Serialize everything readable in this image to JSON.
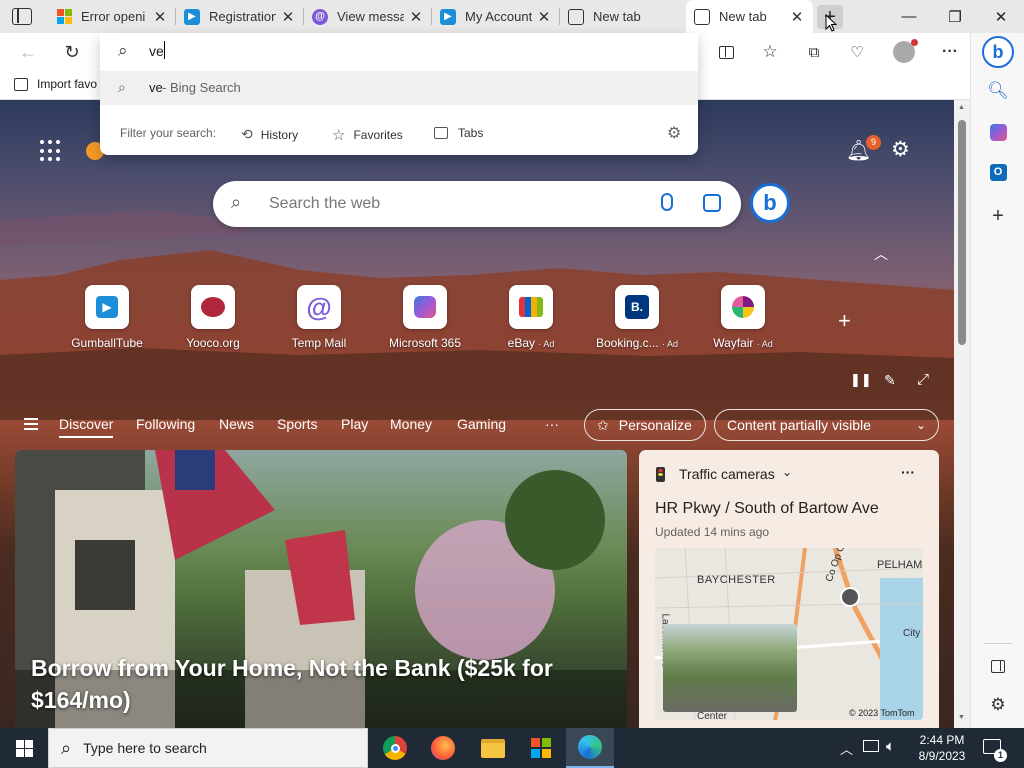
{
  "tabs": [
    {
      "title": "Error openi",
      "icon": "microsoft-icon"
    },
    {
      "title": "Registration",
      "icon": "video-icon"
    },
    {
      "title": "View messa",
      "icon": "at-icon"
    },
    {
      "title": "My Account",
      "icon": "video-icon"
    },
    {
      "title": "New tab",
      "icon": "newtab-icon"
    },
    {
      "title": "New tab",
      "icon": "newtab-icon",
      "active": true
    }
  ],
  "address": {
    "value": "ve"
  },
  "dropdown": {
    "suggestion_query": "ve",
    "suggestion_suffix": " - Bing Search",
    "filter_label": "Filter your search:",
    "filters": [
      "History",
      "Favorites",
      "Tabs"
    ]
  },
  "favorites_bar": {
    "import_label": "Import favo"
  },
  "ntp": {
    "search_placeholder": "Search the web",
    "notification_count": "9",
    "tiles": [
      {
        "label": "GumballTube",
        "ad": ""
      },
      {
        "label": "Yooco.org",
        "ad": ""
      },
      {
        "label": "Temp Mail",
        "ad": ""
      },
      {
        "label": "Microsoft 365",
        "ad": ""
      },
      {
        "label": "eBay",
        "ad": "· Ad"
      },
      {
        "label": "Booking.c...",
        "ad": "· Ad"
      },
      {
        "label": "Wayfair",
        "ad": "· Ad"
      }
    ],
    "nav": [
      "Discover",
      "Following",
      "News",
      "Sports",
      "Play",
      "Money",
      "Gaming"
    ],
    "more": "···",
    "personalize": "Personalize",
    "content_visibility": "Content partially visible"
  },
  "hero": {
    "headline": "Borrow from Your Home, Not the Bank ($25k for $164/mo)"
  },
  "traffic": {
    "header": "Traffic cameras",
    "location": "HR Pkwy / South of Bartow Ave",
    "updated": "Updated 14 mins ago",
    "map_labels": [
      "BAYCHESTER",
      "PELHAM",
      "Co Op Cit",
      "Laconia Ave",
      "Center",
      "City"
    ],
    "copyright": "© 2023 TomTom"
  },
  "taskbar": {
    "search_placeholder": "Type here to search",
    "time": "2:44 PM",
    "date": "8/9/2023",
    "notification_badge": "1"
  },
  "colors": {
    "accent": "#0067c0",
    "bing_blue": "#1a6fd6",
    "badge_orange": "#e8612c"
  }
}
